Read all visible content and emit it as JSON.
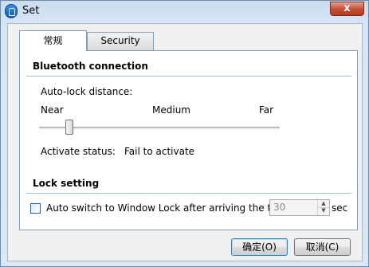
{
  "window": {
    "title": "Set",
    "close_label": "x"
  },
  "tabs": [
    {
      "label": "常规",
      "active": true
    },
    {
      "label": "Security",
      "active": false
    }
  ],
  "bluetooth": {
    "title": "Bluetooth connection",
    "autolock_label": "Auto-lock distance:",
    "slider": {
      "labels": [
        "Near",
        "Medium",
        "Far"
      ],
      "value_fraction": 0.12
    },
    "status_label": "Activate status:",
    "status_value": "Fail to activate"
  },
  "lock": {
    "title": "Lock setting",
    "checkbox_label": "Auto switch to Window Lock after arriving the time",
    "checked": false,
    "time_value": "30",
    "unit": "sec"
  },
  "buttons": {
    "ok": "确定(O)",
    "cancel": "取消(C)"
  }
}
